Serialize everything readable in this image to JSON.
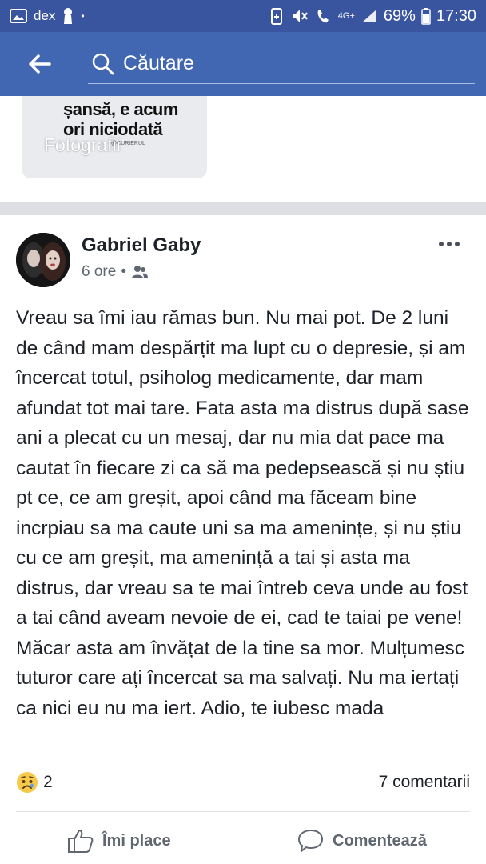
{
  "status_bar": {
    "carrier": "dex",
    "network": "4G+",
    "battery": "69%",
    "time": "17:30"
  },
  "header": {
    "search_placeholder": "Căutare"
  },
  "previous_post": {
    "photo_text_line1": "șansă, e acum",
    "photo_text_line2": "ori niciodată",
    "photo_small_text": "@CURIERUL",
    "photo_label": "Fotografii"
  },
  "post": {
    "author": "Gabriel Gaby",
    "time": "6 ore",
    "dot": "•",
    "audience_icon": "friends-icon",
    "text": "Vreau sa îmi iau rămas bun. Nu mai pot. De 2 luni de când mam despărțit ma lupt cu o depresie, și am încercat totul, psiholog medicamente, dar mam afundat tot mai tare. Fata asta ma distrus după sase ani a plecat cu un mesaj, dar nu mia dat pace ma cautat în fiecare zi ca să ma pedepsească și nu știu pt ce, ce am greșit, apoi când ma făceam bine incrpiau sa ma caute uni sa ma amenințe, și nu știu cu ce am greșit, ma amenință a tai și asta ma distrus, dar vreau sa te mai întreb ceva unde au fost a tai când aveam nevoie de ei, cad te taiai pe vene! Măcar asta am învățat de la tine sa mor. Mulțumesc tuturor care ați încercat sa ma salvați. Nu ma iertați ca nici eu nu ma iert. Adio, te iubesc mada",
    "reaction_icon": "sad-face-icon",
    "reaction_count": "2",
    "comments_count": "7 comentarii",
    "like_label": "Îmi place",
    "comment_label": "Comentează"
  },
  "colors": {
    "status_bar": "#3a559f",
    "app_bar": "#4267b2",
    "separator": "#dddfe2",
    "secondary_text": "#606770"
  }
}
